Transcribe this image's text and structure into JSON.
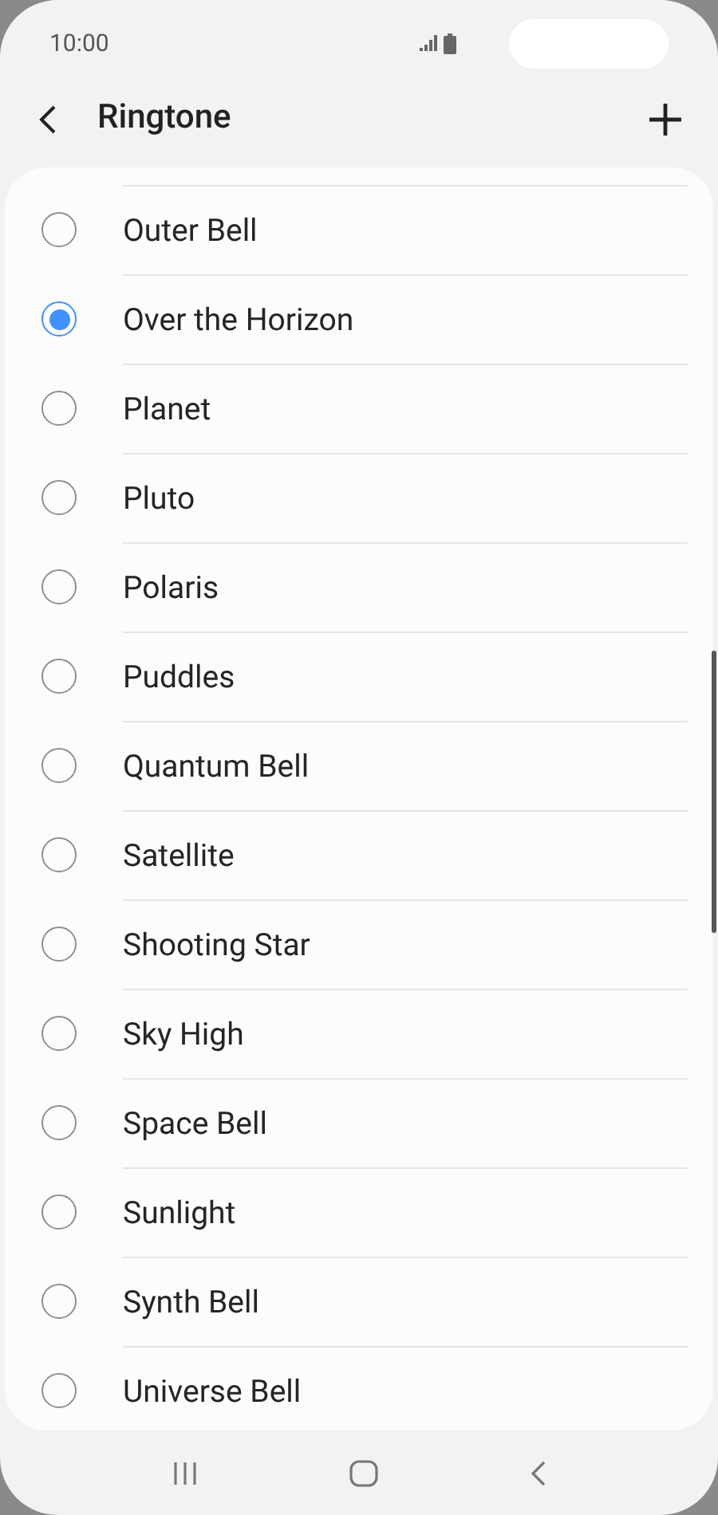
{
  "status_bar": {
    "time": "10:00"
  },
  "header": {
    "title": "Ringtone"
  },
  "ringtones": [
    {
      "label": "Outer Bell",
      "selected": false
    },
    {
      "label": "Over the Horizon",
      "selected": true
    },
    {
      "label": "Planet",
      "selected": false
    },
    {
      "label": "Pluto",
      "selected": false
    },
    {
      "label": "Polaris",
      "selected": false
    },
    {
      "label": "Puddles",
      "selected": false
    },
    {
      "label": "Quantum Bell",
      "selected": false
    },
    {
      "label": "Satellite",
      "selected": false
    },
    {
      "label": "Shooting Star",
      "selected": false
    },
    {
      "label": "Sky High",
      "selected": false
    },
    {
      "label": "Space Bell",
      "selected": false
    },
    {
      "label": "Sunlight",
      "selected": false
    },
    {
      "label": "Synth Bell",
      "selected": false
    },
    {
      "label": "Universe Bell",
      "selected": false
    }
  ]
}
